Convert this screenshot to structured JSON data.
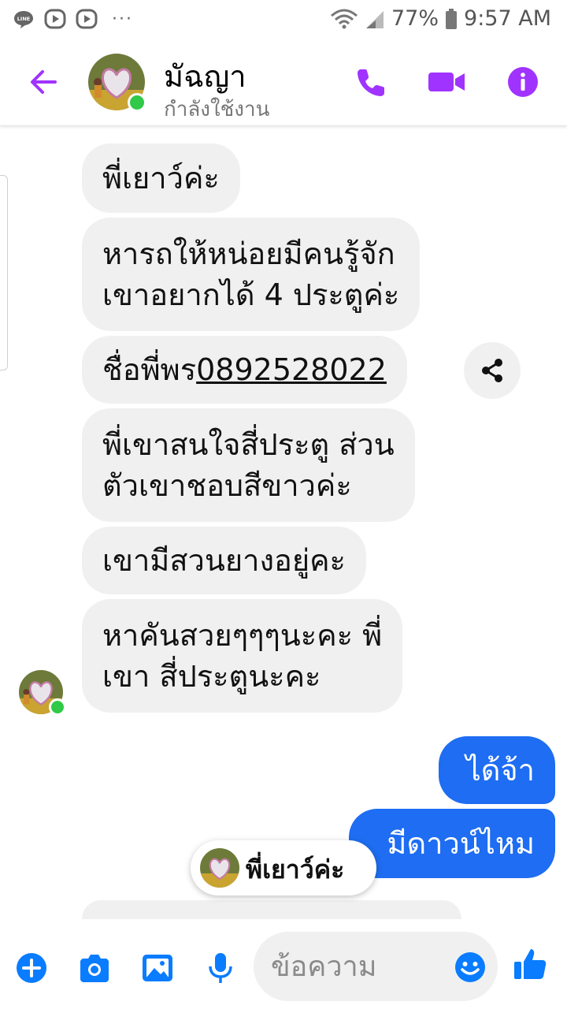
{
  "colors": {
    "accent_purple": "#a033ff",
    "messenger_blue": "#1e6df2",
    "bubble_gray": "#f0f0f0",
    "online_green": "#31c948",
    "icon_blue": "#0a7cff"
  },
  "statusbar": {
    "battery": "77%",
    "time": "9:57 AM",
    "dots": "···",
    "icons": [
      "line-icon",
      "play-icon",
      "play-icon",
      "wifi-icon",
      "signal-icon",
      "battery-icon"
    ]
  },
  "header": {
    "name": "มัฉญา",
    "status": "กำลังใช้งาน",
    "icons": [
      "back-arrow-icon",
      "phone-icon",
      "video-camera-icon",
      "info-icon"
    ]
  },
  "messages": {
    "m1": "พี่เยาว์ค่ะ",
    "m2_line1": "หารถให้หน่อยมีคนรู้จัก",
    "m2_line2": "เขาอยากได้ 4 ประตูค่ะ",
    "m3_prefix": "ชื่อพี่พร",
    "m3_phone": "0892528022",
    "m4_line1": "พี่เขาสนใจสี่ประตู ส่วน",
    "m4_line2": "ตัวเขาชอบสีขาวค่ะ",
    "m5": "เขามีสวนยางอยู่คะ",
    "m6_line1": "หาคันสวยๆๆๆนะคะ พี่",
    "m6_line2": "เขา สี่ประตูนะคะ",
    "out1": "ได้จ้า",
    "out2": "มีดาวน์ไหม"
  },
  "reply_chip": {
    "text": "พี่เยาว์ค่ะ"
  },
  "composer": {
    "placeholder": "ข้อความ",
    "icons": [
      "plus-icon",
      "camera-icon",
      "gallery-icon",
      "microphone-icon",
      "emoji-icon",
      "thumbs-up-icon"
    ]
  }
}
